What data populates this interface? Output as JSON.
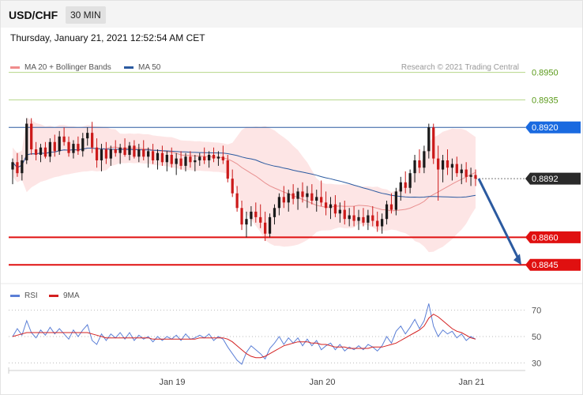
{
  "header": {
    "symbol": "USD/CHF",
    "timeframe": "30 MIN"
  },
  "date_line": "Thursday, January 21, 2021 12:52:54 AM CET",
  "legend": [
    {
      "label": "MA 20 + Bollinger Bands",
      "color": "#f08c8c"
    },
    {
      "label": "MA 50",
      "color": "#2b5aa0"
    }
  ],
  "credit": "Research © 2021 Trading Central",
  "rsi_legend": [
    {
      "label": "RSI",
      "color": "#5b7fd6"
    },
    {
      "label": "9MA",
      "color": "#d42020"
    }
  ],
  "colors": {
    "up": "#1a1a1a",
    "down": "#cc1a1a",
    "green_level": "#5a9a1a",
    "blue_level": "#1a6ae0",
    "red_level": "#e01010",
    "current": "#2a2a2a",
    "bands": "#fde0e0",
    "arrow": "#2b5aa0"
  },
  "chart_data": [
    {
      "type": "candlestick",
      "yaxis": "price",
      "ylim": [
        0.883,
        0.8955
      ],
      "levels": [
        {
          "label": "0.8950",
          "value": 0.895,
          "style": "green"
        },
        {
          "label": "0.8935",
          "value": 0.8935,
          "style": "green"
        },
        {
          "label": "0.8920",
          "value": 0.892,
          "style": "blue"
        },
        {
          "label": "0.8892",
          "value": 0.8892,
          "style": "current"
        },
        {
          "label": "0.8860",
          "value": 0.886,
          "style": "red"
        },
        {
          "label": "0.8845",
          "value": 0.8845,
          "style": "red"
        }
      ],
      "forecast": {
        "from": 0.8892,
        "to": 0.8845
      },
      "x_labels": [
        "Jan 19",
        "Jan 20",
        "Jan 21"
      ],
      "candles": [
        [
          0.8897,
          0.8903,
          0.8889,
          0.8901
        ],
        [
          0.8901,
          0.8906,
          0.8893,
          0.8895
        ],
        [
          0.8895,
          0.8905,
          0.8891,
          0.8902
        ],
        [
          0.8902,
          0.8925,
          0.89,
          0.8922
        ],
        [
          0.8922,
          0.8925,
          0.8905,
          0.8908
        ],
        [
          0.8908,
          0.8912,
          0.8902,
          0.8905
        ],
        [
          0.8905,
          0.8911,
          0.8901,
          0.8909
        ],
        [
          0.8909,
          0.8912,
          0.8903,
          0.8904
        ],
        [
          0.8904,
          0.8914,
          0.8901,
          0.8912
        ],
        [
          0.8912,
          0.8916,
          0.8904,
          0.8907
        ],
        [
          0.8907,
          0.8918,
          0.8905,
          0.8915
        ],
        [
          0.8915,
          0.892,
          0.891,
          0.8912
        ],
        [
          0.8912,
          0.8915,
          0.8904,
          0.8906
        ],
        [
          0.8906,
          0.8913,
          0.8903,
          0.8911
        ],
        [
          0.8911,
          0.8915,
          0.8905,
          0.8907
        ],
        [
          0.8907,
          0.8917,
          0.8904,
          0.8914
        ],
        [
          0.8914,
          0.892,
          0.891,
          0.8917
        ],
        [
          0.8917,
          0.8923,
          0.8906,
          0.8909
        ],
        [
          0.8909,
          0.8914,
          0.8898,
          0.8902
        ],
        [
          0.8902,
          0.8911,
          0.8896,
          0.8908
        ],
        [
          0.8908,
          0.8912,
          0.89,
          0.8903
        ],
        [
          0.8903,
          0.891,
          0.8899,
          0.8908
        ],
        [
          0.8908,
          0.8913,
          0.8904,
          0.8906
        ],
        [
          0.8906,
          0.8911,
          0.89,
          0.8909
        ],
        [
          0.8909,
          0.8914,
          0.8904,
          0.8905
        ],
        [
          0.8905,
          0.8912,
          0.8902,
          0.891
        ],
        [
          0.891,
          0.8913,
          0.8903,
          0.8904
        ],
        [
          0.8904,
          0.8911,
          0.8901,
          0.8908
        ],
        [
          0.8908,
          0.8913,
          0.8902,
          0.8904
        ],
        [
          0.8904,
          0.8909,
          0.8898,
          0.8907
        ],
        [
          0.8907,
          0.8911,
          0.89,
          0.8902
        ],
        [
          0.8902,
          0.8908,
          0.8897,
          0.8906
        ],
        [
          0.8906,
          0.891,
          0.8899,
          0.8901
        ],
        [
          0.8901,
          0.8907,
          0.8896,
          0.8905
        ],
        [
          0.8905,
          0.8909,
          0.8898,
          0.89
        ],
        [
          0.89,
          0.8906,
          0.8894,
          0.8903
        ],
        [
          0.8903,
          0.8907,
          0.8897,
          0.8899
        ],
        [
          0.8899,
          0.8906,
          0.8896,
          0.8904
        ],
        [
          0.8904,
          0.8907,
          0.8898,
          0.8901
        ],
        [
          0.8901,
          0.8905,
          0.8896,
          0.8902
        ],
        [
          0.8902,
          0.8906,
          0.8899,
          0.8904
        ],
        [
          0.8904,
          0.8909,
          0.89,
          0.8902
        ],
        [
          0.8902,
          0.8907,
          0.8898,
          0.8905
        ],
        [
          0.8905,
          0.8909,
          0.8901,
          0.8903
        ],
        [
          0.8903,
          0.8907,
          0.8899,
          0.8904
        ],
        [
          0.8904,
          0.891,
          0.89,
          0.8902
        ],
        [
          0.8902,
          0.8905,
          0.889,
          0.8892
        ],
        [
          0.8892,
          0.8897,
          0.8882,
          0.8884
        ],
        [
          0.8884,
          0.8888,
          0.8874,
          0.8876
        ],
        [
          0.8876,
          0.888,
          0.8864,
          0.8867
        ],
        [
          0.8867,
          0.8874,
          0.886,
          0.887
        ],
        [
          0.887,
          0.8877,
          0.8866,
          0.8874
        ],
        [
          0.8874,
          0.8879,
          0.8868,
          0.8871
        ],
        [
          0.8871,
          0.8878,
          0.8865,
          0.8868
        ],
        [
          0.8868,
          0.8874,
          0.8858,
          0.8862
        ],
        [
          0.8862,
          0.8873,
          0.886,
          0.8871
        ],
        [
          0.8871,
          0.8878,
          0.8867,
          0.8876
        ],
        [
          0.8876,
          0.8884,
          0.8872,
          0.8882
        ],
        [
          0.8882,
          0.8888,
          0.8876,
          0.8879
        ],
        [
          0.8879,
          0.8886,
          0.8874,
          0.8884
        ],
        [
          0.8884,
          0.8889,
          0.8878,
          0.8881
        ],
        [
          0.8881,
          0.8887,
          0.8875,
          0.8885
        ],
        [
          0.8885,
          0.889,
          0.8879,
          0.8882
        ],
        [
          0.8882,
          0.8888,
          0.8876,
          0.8884
        ],
        [
          0.8884,
          0.8889,
          0.8878,
          0.888
        ],
        [
          0.888,
          0.8886,
          0.8874,
          0.8882
        ],
        [
          0.8882,
          0.8891,
          0.8877,
          0.8879
        ],
        [
          0.8879,
          0.8885,
          0.8872,
          0.8876
        ],
        [
          0.8876,
          0.8882,
          0.887,
          0.8878
        ],
        [
          0.8878,
          0.8883,
          0.8871,
          0.8873
        ],
        [
          0.8873,
          0.8879,
          0.8868,
          0.8875
        ],
        [
          0.8875,
          0.888,
          0.8867,
          0.887
        ],
        [
          0.887,
          0.8876,
          0.8866,
          0.8872
        ],
        [
          0.8872,
          0.8877,
          0.8866,
          0.8869
        ],
        [
          0.8869,
          0.8875,
          0.8864,
          0.8871
        ],
        [
          0.8871,
          0.8876,
          0.8866,
          0.8868
        ],
        [
          0.8868,
          0.8875,
          0.8864,
          0.8872
        ],
        [
          0.8872,
          0.8877,
          0.8866,
          0.8869
        ],
        [
          0.8869,
          0.8874,
          0.8863,
          0.8866
        ],
        [
          0.8866,
          0.8873,
          0.8862,
          0.887
        ],
        [
          0.887,
          0.888,
          0.8867,
          0.8878
        ],
        [
          0.8878,
          0.8884,
          0.8873,
          0.8875
        ],
        [
          0.8875,
          0.8887,
          0.8872,
          0.8885
        ],
        [
          0.8885,
          0.8893,
          0.888,
          0.889
        ],
        [
          0.889,
          0.8896,
          0.8884,
          0.8887
        ],
        [
          0.8887,
          0.8897,
          0.8884,
          0.8895
        ],
        [
          0.8895,
          0.8905,
          0.889,
          0.8902
        ],
        [
          0.8902,
          0.8908,
          0.8895,
          0.8898
        ],
        [
          0.8898,
          0.891,
          0.8895,
          0.8907
        ],
        [
          0.8907,
          0.8922,
          0.8903,
          0.892
        ],
        [
          0.892,
          0.8922,
          0.89,
          0.8903
        ],
        [
          0.8903,
          0.891,
          0.888,
          0.8897
        ],
        [
          0.8897,
          0.8905,
          0.889,
          0.8902
        ],
        [
          0.8902,
          0.8908,
          0.8894,
          0.8898
        ],
        [
          0.8898,
          0.8903,
          0.8891,
          0.89
        ],
        [
          0.89,
          0.8904,
          0.8893,
          0.8895
        ],
        [
          0.8895,
          0.89,
          0.8889,
          0.8897
        ],
        [
          0.8897,
          0.8901,
          0.889,
          0.8893
        ],
        [
          0.8893,
          0.8898,
          0.8888,
          0.8894
        ],
        [
          0.8894,
          0.8897,
          0.8888,
          0.8892
        ]
      ]
    },
    {
      "type": "line",
      "yaxis": "RSI",
      "ylim": [
        20,
        80
      ],
      "ticks": [
        70,
        50,
        30
      ],
      "series": [
        {
          "name": "RSI",
          "values": [
            50,
            56,
            51,
            62,
            53,
            49,
            55,
            51,
            57,
            52,
            56,
            52,
            48,
            55,
            50,
            55,
            59,
            47,
            44,
            52,
            47,
            52,
            49,
            53,
            48,
            53,
            47,
            51,
            48,
            50,
            46,
            50,
            47,
            50,
            48,
            51,
            47,
            52,
            48,
            49,
            51,
            49,
            52,
            47,
            50,
            48,
            42,
            37,
            32,
            29,
            38,
            43,
            40,
            37,
            33,
            41,
            45,
            50,
            44,
            49,
            45,
            49,
            43,
            48,
            43,
            47,
            40,
            43,
            45,
            40,
            44,
            39,
            42,
            40,
            43,
            40,
            44,
            42,
            39,
            43,
            50,
            45,
            54,
            58,
            52,
            57,
            63,
            56,
            62,
            75,
            58,
            50,
            55,
            52,
            54,
            49,
            52,
            47,
            50,
            48
          ]
        },
        {
          "name": "9MA",
          "values": [
            50,
            51,
            52,
            53,
            53,
            53,
            53,
            53,
            53,
            53,
            53,
            53,
            53,
            53,
            53,
            53,
            53,
            52,
            51,
            50,
            49,
            49,
            49,
            49,
            49,
            49,
            49,
            49,
            49,
            49,
            48,
            48,
            48,
            48,
            48,
            48,
            48,
            48,
            48,
            48,
            49,
            49,
            49,
            49,
            49,
            49,
            48,
            46,
            43,
            40,
            37,
            35,
            34,
            34,
            35,
            37,
            39,
            41,
            43,
            44,
            45,
            46,
            46,
            46,
            45,
            45,
            44,
            44,
            43,
            42,
            42,
            42,
            41,
            41,
            41,
            41,
            41,
            42,
            42,
            42,
            43,
            44,
            45,
            47,
            49,
            51,
            53,
            55,
            58,
            64,
            67,
            65,
            62,
            59,
            56,
            54,
            53,
            51,
            49,
            48
          ]
        }
      ],
      "x_labels": [
        "Jan 19",
        "Jan 20",
        "Jan 21"
      ]
    }
  ]
}
